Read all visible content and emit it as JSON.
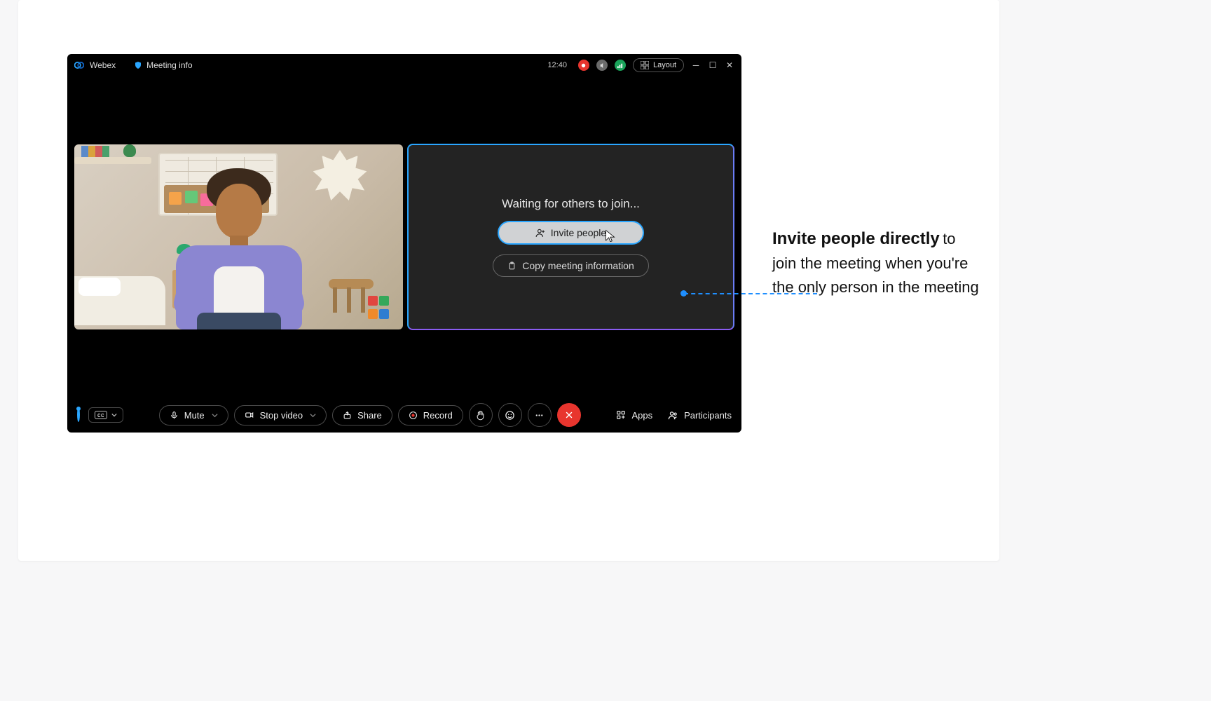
{
  "titlebar": {
    "app_name": "Webex",
    "meeting_info_label": "Meeting info",
    "clock": "12:40",
    "layout_label": "Layout"
  },
  "waiting": {
    "status_text": "Waiting for others to join...",
    "invite_label": "Invite people",
    "copy_label": "Copy meeting information"
  },
  "controls": {
    "mute": "Mute",
    "stop_video": "Stop video",
    "share": "Share",
    "record": "Record",
    "apps": "Apps",
    "participants": "Participants",
    "cc": "cc"
  },
  "callout": {
    "bold": "Invite people directly",
    "rest": "to join the meeting when you're the only person in the meeting"
  },
  "colors": {
    "accent_blue": "#2aa6ff",
    "end_red": "#e8352e",
    "status_green": "#1aa35a"
  }
}
